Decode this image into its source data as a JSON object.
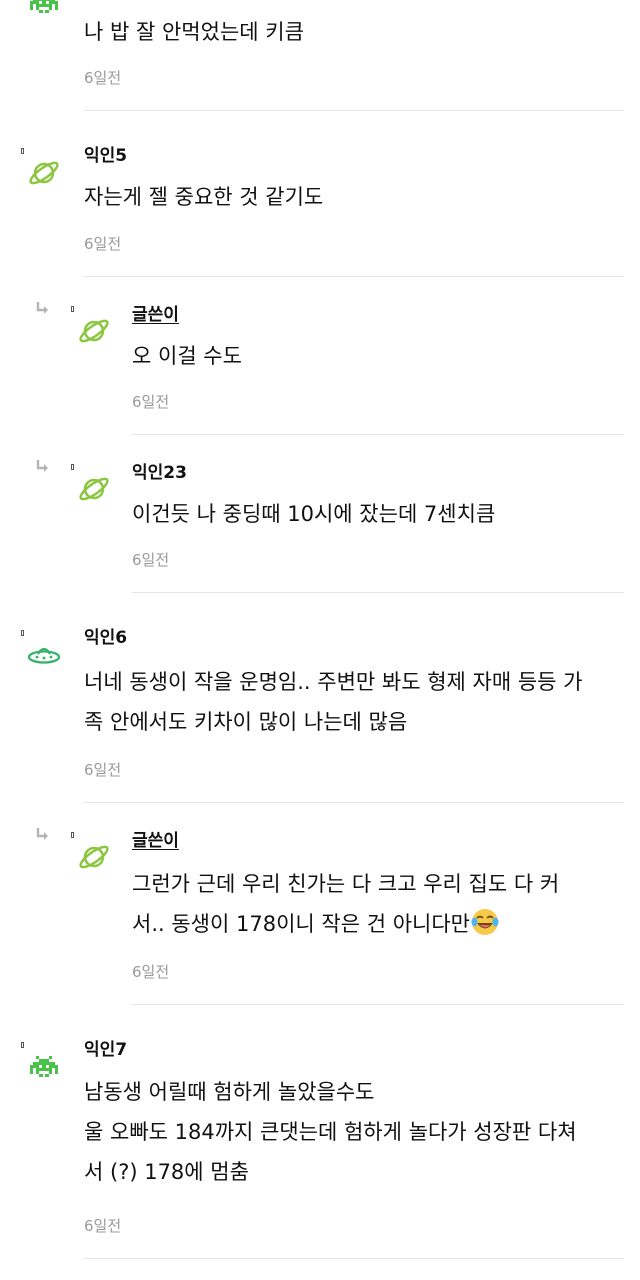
{
  "comments": [
    {
      "author": "",
      "body": [
        "나 밥 잘 안먹었는데 키큼"
      ],
      "time": "6일전",
      "avatar_icon": "alien-invader-icon"
    },
    {
      "author": "익인5",
      "body": [
        "자는게 젤 중요한 것 같기도"
      ],
      "time": "6일전",
      "avatar_icon": "planet-icon"
    },
    {
      "author": "글쓴이",
      "body": [
        "오 이걸 수도"
      ],
      "time": "6일전",
      "avatar_icon": "planet-icon",
      "is_reply": true
    },
    {
      "author": "익인23",
      "body": [
        "이건듯 나 중딩때 10시에 잤는데 7센치큼"
      ],
      "time": "6일전",
      "avatar_icon": "planet-icon",
      "is_reply": true
    },
    {
      "author": "익인6",
      "body": [
        "너네 동생이 작을 운명임.. 주변만 봐도 형제 자매 등등 가",
        "족 안에서도 키차이 많이 나는데 많음"
      ],
      "time": "6일전",
      "avatar_icon": "ufo-icon"
    },
    {
      "author": "글쓴이",
      "body": [
        "그런가 근데 우리 친가는 다 크고 우리 집도 다 커",
        "서.. 동생이 178이니 작은 건 아니다만"
      ],
      "time": "6일전",
      "avatar_icon": "planet-icon",
      "is_reply": true,
      "emoji": "laughing-crying-emoji"
    },
    {
      "author": "익인7",
      "body": [
        "남동생 어릴때 험하게 놀았을수도",
        "울 오빠도 184까지 큰댓는데 험하게 놀다가 성장판 다쳐",
        "서 (?) 178에 멈춤"
      ],
      "time": "6일전",
      "avatar_icon": "alien-invader-icon"
    }
  ],
  "colors": {
    "alien": "#49c24a",
    "planet": "#8cc63f",
    "ufo": "#36b36b",
    "time": "#9a9a9a",
    "divider": "#e6e6e6"
  }
}
